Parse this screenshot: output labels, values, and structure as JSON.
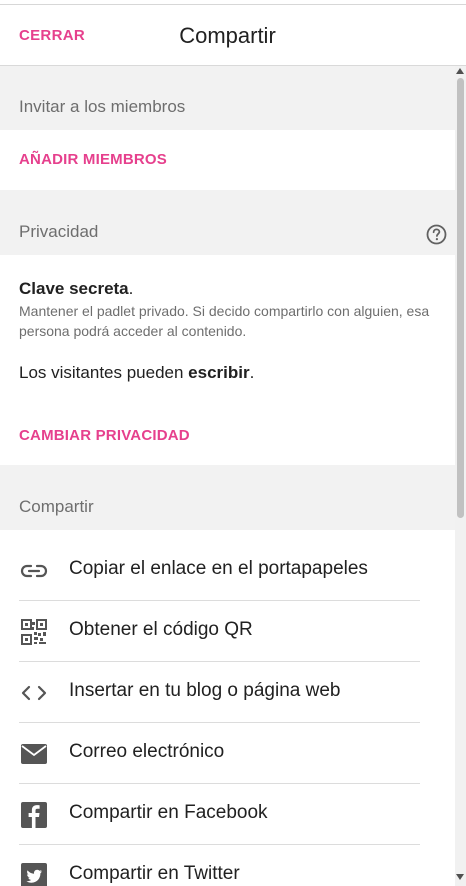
{
  "header": {
    "close_label": "CERRAR",
    "title": "Compartir"
  },
  "invite": {
    "heading": "Invitar a los miembros",
    "add_members": "AÑADIR MIEMBROS"
  },
  "privacy": {
    "heading": "Privacidad",
    "mode_title": "Clave secreta",
    "mode_suffix": ".",
    "description": "Mantener el padlet privado. Si decido compartirlo con alguien, esa persona podrá acceder al contenido.",
    "visitors_prefix": "Los visitantes pueden ",
    "visitors_permission": "escribir",
    "visitors_suffix": ".",
    "change_label": "CAMBIAR PRIVACIDAD"
  },
  "share": {
    "heading": "Compartir",
    "items": [
      {
        "label": "Copiar el enlace en el portapapeles",
        "icon": "link-icon"
      },
      {
        "label": "Obtener el código QR",
        "icon": "qr-code-icon"
      },
      {
        "label": "Insertar en tu blog o página web",
        "icon": "embed-code-icon"
      },
      {
        "label": "Correo electrónico",
        "icon": "mail-icon"
      },
      {
        "label": "Compartir en Facebook",
        "icon": "facebook-icon"
      },
      {
        "label": "Compartir en Twitter",
        "icon": "twitter-icon"
      }
    ]
  },
  "colors": {
    "accent": "#e6408d",
    "section_bg": "#f2f2f2",
    "icon": "#555555"
  }
}
